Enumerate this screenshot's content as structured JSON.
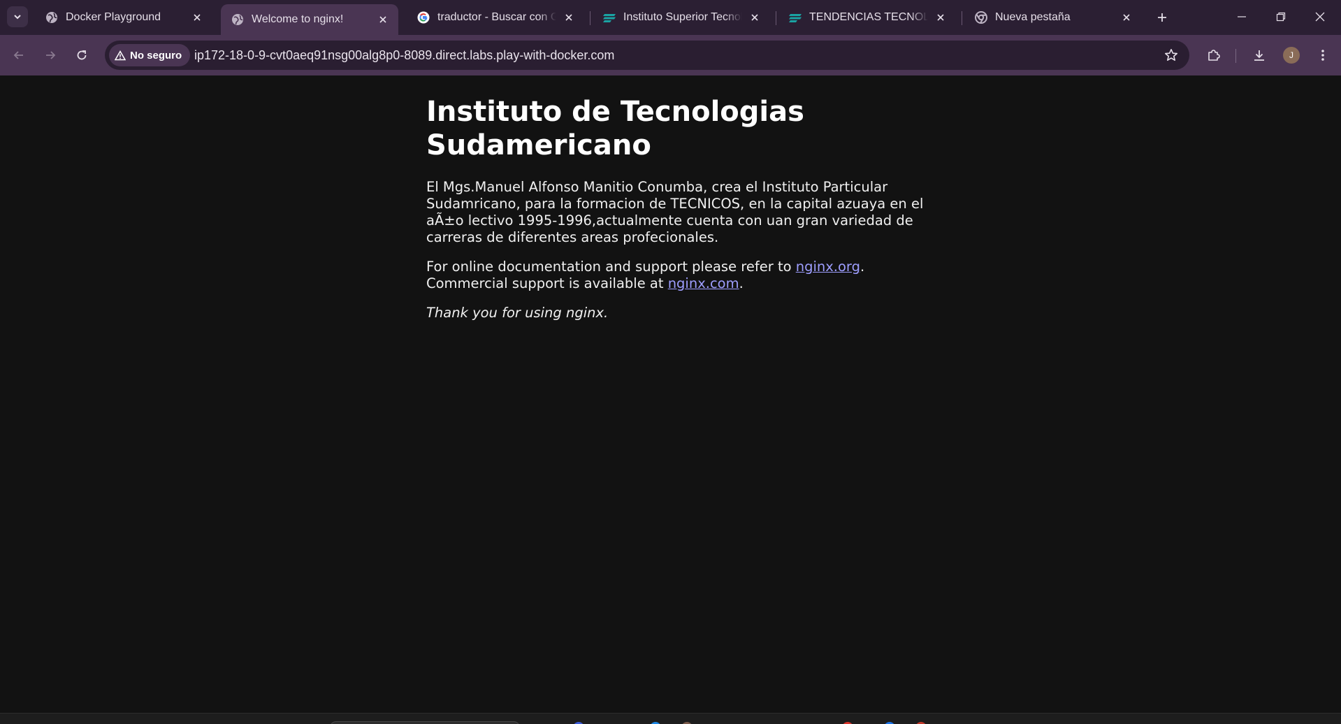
{
  "tabs": [
    {
      "title": "Docker Playground",
      "favicon": "globe-icon"
    },
    {
      "title": "Welcome to nginx!",
      "favicon": "globe-icon",
      "active": true
    },
    {
      "title": "traductor - Buscar con Google",
      "favicon": "google-icon"
    },
    {
      "title": "Instituto Superior Tecnológico",
      "favicon": "course-icon"
    },
    {
      "title": "TENDENCIAS TECNOLOGICAS",
      "favicon": "course-icon"
    },
    {
      "title": "Nueva pestaña",
      "favicon": "chrome-icon"
    }
  ],
  "toolbar": {
    "security_label": "No seguro",
    "url": "ip172-18-0-9-cvt0aeq91nsg00alg8p0-8089.direct.labs.play-with-docker.com",
    "profile_initial": "J"
  },
  "page": {
    "heading": "Instituto de Tecnologias Sudamericano",
    "paragraph1": "El Mgs.Manuel Alfonso Manitio Conumba, crea el Instituto Particular Sudamricano, para la formacion de TECNICOS, en la capital azuaya en el aÃ±o lectivo 1995-1996,actualmente cuenta con uan gran variedad de carreras de diferentes areas profecionales.",
    "doc_text": "For online documentation and support please refer to ",
    "doc_link": "nginx.org",
    "commercial_text": "Commercial support is available at ",
    "commercial_link": "nginx.com",
    "period": ".",
    "thanks": "Thank you for using nginx."
  },
  "colors": {
    "tab_strip": "#2b1f33",
    "toolbar": "#4a3553",
    "page_bg": "#121212",
    "link": "#9e9eff",
    "course_icon": "#1aa3a3"
  }
}
